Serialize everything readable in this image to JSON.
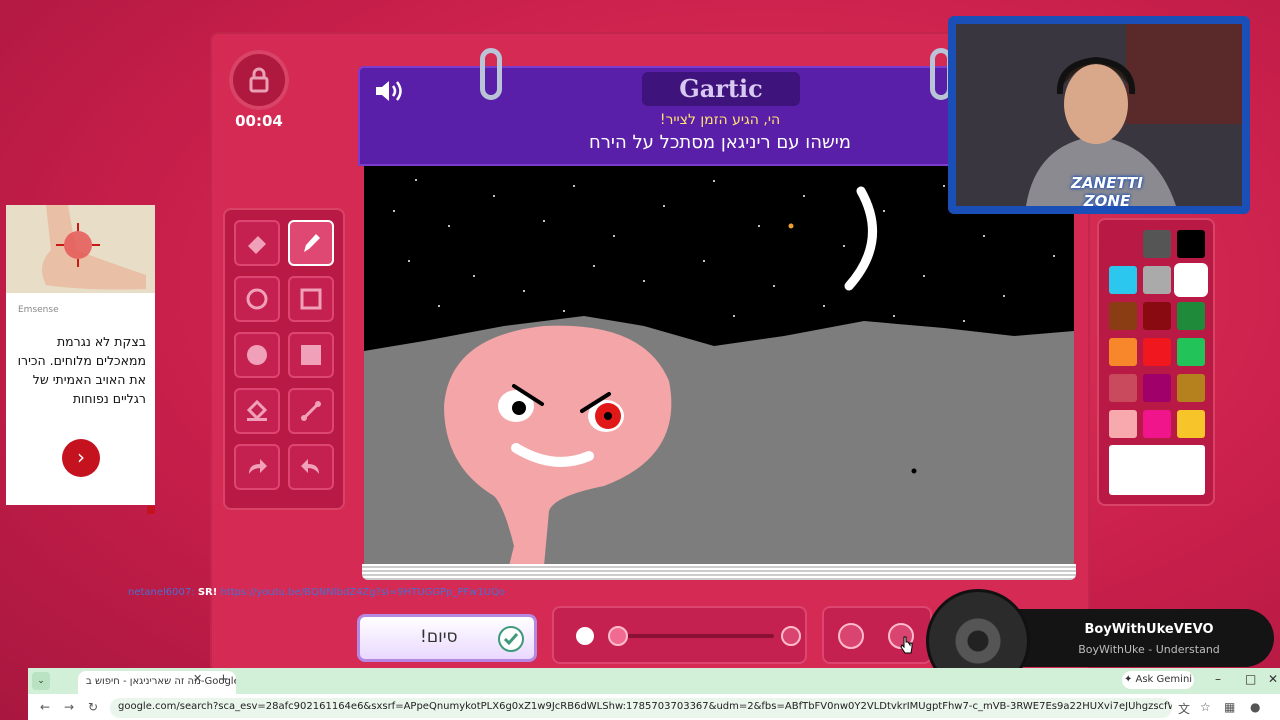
{
  "game": {
    "timer": "00:04",
    "logo": "Gartic",
    "hint_line1": "הי, הגיע הזמן לצייר!",
    "hint_line2": "מישהו עם ריניגאן מסתכל על הירח",
    "done_label": "סיום!"
  },
  "tools": [
    "eraser-icon",
    "pencil-icon",
    "circle-outline-icon",
    "square-outline-icon",
    "circle-fill-icon",
    "square-fill-icon",
    "fill-bucket-icon",
    "line-icon",
    "redo-icon",
    "undo-icon"
  ],
  "palette": {
    "colors": [
      "#555555",
      "#000000",
      "#2bc7ef",
      "#aaaaaa",
      "#ffffff",
      "#8a3d12",
      "#8a0a12",
      "#1f8a3a",
      "#f7872a",
      "#f0171f",
      "#22c45a",
      "#c84a5c",
      "#a0006a",
      "#b5801e",
      "#f7a9ad",
      "#f0158a",
      "#f7c52a"
    ],
    "selected": "#ffffff"
  },
  "ad": {
    "brand": "Emsense",
    "text": "בצקת לא נגרמת ממאכלים מלוחים. הכירו את האויב האמיתי של רגליים נפוחות",
    "button": "›"
  },
  "chat": {
    "user": "netanel6007",
    "command": "SR!",
    "link": "https://youtu.be/BQNNlbdZ4Zg?si=9HTUGGPp_PFw1UQo"
  },
  "stream": {
    "channel_badge_1": "ZANETTI",
    "channel_badge_2": "ZONE"
  },
  "now_playing": {
    "artist": "BoyWithUkeVEVO",
    "song": "BoyWithUke - Understand"
  },
  "browser": {
    "tab_title": "מה זה שאריניגאן - חיפוש ב-Google",
    "ask_gemini": "Ask Gemini",
    "url": "google.com/search?sca_esv=28afc902161164e6&sxsrf=APpeQnumykotPLX6g0xZ1w9JcRB6dWLShw:1785703703367&udm=2&fbs=ABfTbFV0nw0Y2VLDtvkrIMUgptFhw7-c_mVB-3RWE7Es9a22HUXvi7eJUhgzscfWKP_C6uOg1fetmuEkqZ1UGMEni-xDg6..."
  }
}
